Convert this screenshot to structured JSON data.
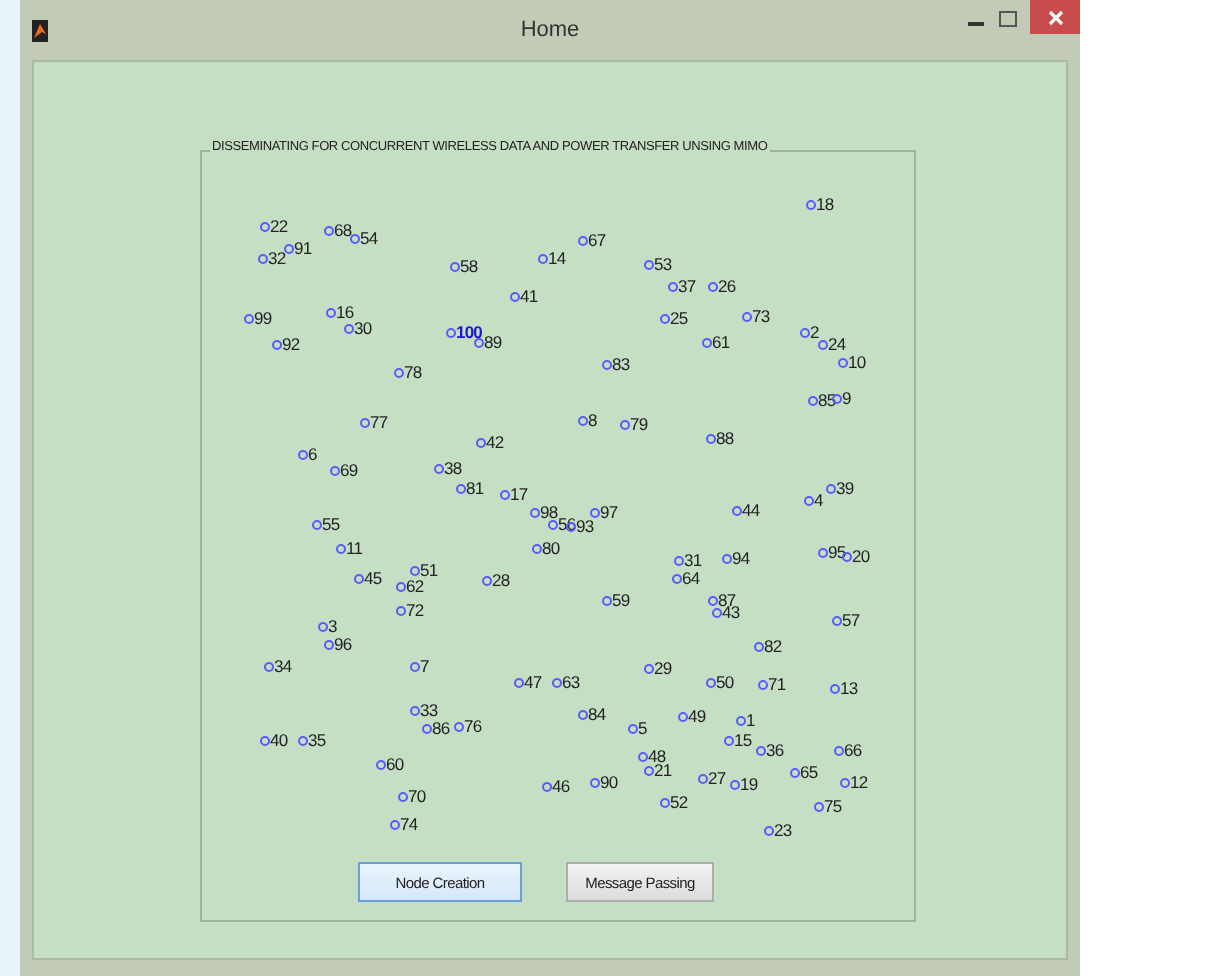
{
  "window": {
    "title": "Home"
  },
  "panel": {
    "title": "DISSEMINATING FOR CONCURRENT WIRELESS DATA AND POWER TRANSFER UNSING MIMO"
  },
  "nodes": [
    {
      "label": "18",
      "selected": false
    },
    {
      "label": "22",
      "selected": false
    },
    {
      "label": "68",
      "selected": false
    },
    {
      "label": "54",
      "selected": false
    },
    {
      "label": "91",
      "selected": false
    },
    {
      "label": "32",
      "selected": false
    },
    {
      "label": "58",
      "selected": false
    },
    {
      "label": "14",
      "selected": false
    },
    {
      "label": "67",
      "selected": false
    },
    {
      "label": "53",
      "selected": false
    },
    {
      "label": "37",
      "selected": false
    },
    {
      "label": "26",
      "selected": false
    },
    {
      "label": "41",
      "selected": false
    },
    {
      "label": "99",
      "selected": false
    },
    {
      "label": "16",
      "selected": false
    },
    {
      "label": "30",
      "selected": false
    },
    {
      "label": "92",
      "selected": false
    },
    {
      "label": "100",
      "selected": true
    },
    {
      "label": "89",
      "selected": false
    },
    {
      "label": "25",
      "selected": false
    },
    {
      "label": "73",
      "selected": false
    },
    {
      "label": "61",
      "selected": false
    },
    {
      "label": "2",
      "selected": false
    },
    {
      "label": "24",
      "selected": false
    },
    {
      "label": "10",
      "selected": false
    },
    {
      "label": "83",
      "selected": false
    },
    {
      "label": "78",
      "selected": false
    },
    {
      "label": "85",
      "selected": false
    },
    {
      "label": "9",
      "selected": false
    },
    {
      "label": "77",
      "selected": false
    },
    {
      "label": "8",
      "selected": false
    },
    {
      "label": "79",
      "selected": false
    },
    {
      "label": "88",
      "selected": false
    },
    {
      "label": "42",
      "selected": false
    },
    {
      "label": "6",
      "selected": false
    },
    {
      "label": "69",
      "selected": false
    },
    {
      "label": "38",
      "selected": false
    },
    {
      "label": "81",
      "selected": false
    },
    {
      "label": "17",
      "selected": false
    },
    {
      "label": "98",
      "selected": false
    },
    {
      "label": "56",
      "selected": false
    },
    {
      "label": "93",
      "selected": false
    },
    {
      "label": "97",
      "selected": false
    },
    {
      "label": "44",
      "selected": false
    },
    {
      "label": "4",
      "selected": false
    },
    {
      "label": "39",
      "selected": false
    },
    {
      "label": "55",
      "selected": false
    },
    {
      "label": "11",
      "selected": false
    },
    {
      "label": "80",
      "selected": false
    },
    {
      "label": "31",
      "selected": false
    },
    {
      "label": "94",
      "selected": false
    },
    {
      "label": "95",
      "selected": false
    },
    {
      "label": "20",
      "selected": false
    },
    {
      "label": "45",
      "selected": false
    },
    {
      "label": "51",
      "selected": false
    },
    {
      "label": "62",
      "selected": false
    },
    {
      "label": "28",
      "selected": false
    },
    {
      "label": "64",
      "selected": false
    },
    {
      "label": "72",
      "selected": false
    },
    {
      "label": "59",
      "selected": false
    },
    {
      "label": "87",
      "selected": false
    },
    {
      "label": "43",
      "selected": false
    },
    {
      "label": "57",
      "selected": false
    },
    {
      "label": "82",
      "selected": false
    },
    {
      "label": "3",
      "selected": false
    },
    {
      "label": "96",
      "selected": false
    },
    {
      "label": "34",
      "selected": false
    },
    {
      "label": "7",
      "selected": false
    },
    {
      "label": "29",
      "selected": false
    },
    {
      "label": "47",
      "selected": false
    },
    {
      "label": "63",
      "selected": false
    },
    {
      "label": "50",
      "selected": false
    },
    {
      "label": "71",
      "selected": false
    },
    {
      "label": "13",
      "selected": false
    },
    {
      "label": "33",
      "selected": false
    },
    {
      "label": "86",
      "selected": false
    },
    {
      "label": "76",
      "selected": false
    },
    {
      "label": "84",
      "selected": false
    },
    {
      "label": "5",
      "selected": false
    },
    {
      "label": "49",
      "selected": false
    },
    {
      "label": "40",
      "selected": false
    },
    {
      "label": "35",
      "selected": false
    },
    {
      "label": "1",
      "selected": false
    },
    {
      "label": "15",
      "selected": false
    },
    {
      "label": "36",
      "selected": false
    },
    {
      "label": "66",
      "selected": false
    },
    {
      "label": "48",
      "selected": false
    },
    {
      "label": "21",
      "selected": false
    },
    {
      "label": "60",
      "selected": false
    },
    {
      "label": "46",
      "selected": false
    },
    {
      "label": "90",
      "selected": false
    },
    {
      "label": "27",
      "selected": false
    },
    {
      "label": "19",
      "selected": false
    },
    {
      "label": "65",
      "selected": false
    },
    {
      "label": "12",
      "selected": false
    },
    {
      "label": "52",
      "selected": false
    },
    {
      "label": "70",
      "selected": false
    },
    {
      "label": "75",
      "selected": false
    },
    {
      "label": "74",
      "selected": false
    },
    {
      "label": "23",
      "selected": false
    }
  ],
  "buttons": [
    {
      "label": "Node Creation",
      "selected": true
    },
    {
      "label": "Message Passing",
      "selected": false
    }
  ]
}
